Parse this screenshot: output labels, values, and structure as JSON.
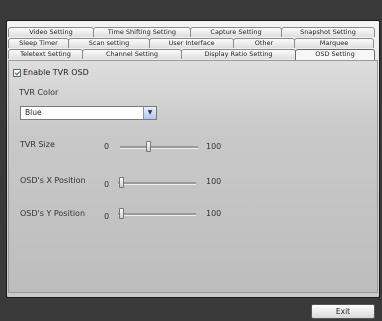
{
  "tabs": {
    "row1": [
      "Video Setting",
      "Time Shifting Setting",
      "Capture Setting",
      "Snapshot Setting"
    ],
    "row2": [
      "Sleep Timer",
      "Scan setting",
      "User Interface",
      "Other",
      "Marquee"
    ],
    "row3": [
      "Teletext Setting",
      "Channel Setting",
      "Display Ratio Setting",
      "OSD Setting"
    ],
    "active": "OSD Setting"
  },
  "osd": {
    "enable_label": "Enable TVR OSD",
    "enable_checked": true,
    "color_label": "TVR Color",
    "color_value": "Blue",
    "size_label": "TVR Size",
    "size_min": "0",
    "size_max": "100",
    "size_value": 35,
    "x_label": "OSD's X Position",
    "x_min": "0",
    "x_max": "100",
    "x_value": 2,
    "y_label": "OSD's Y Position",
    "y_min": "0",
    "y_max": "100",
    "y_value": 2
  },
  "buttons": {
    "exit": "Exit"
  }
}
